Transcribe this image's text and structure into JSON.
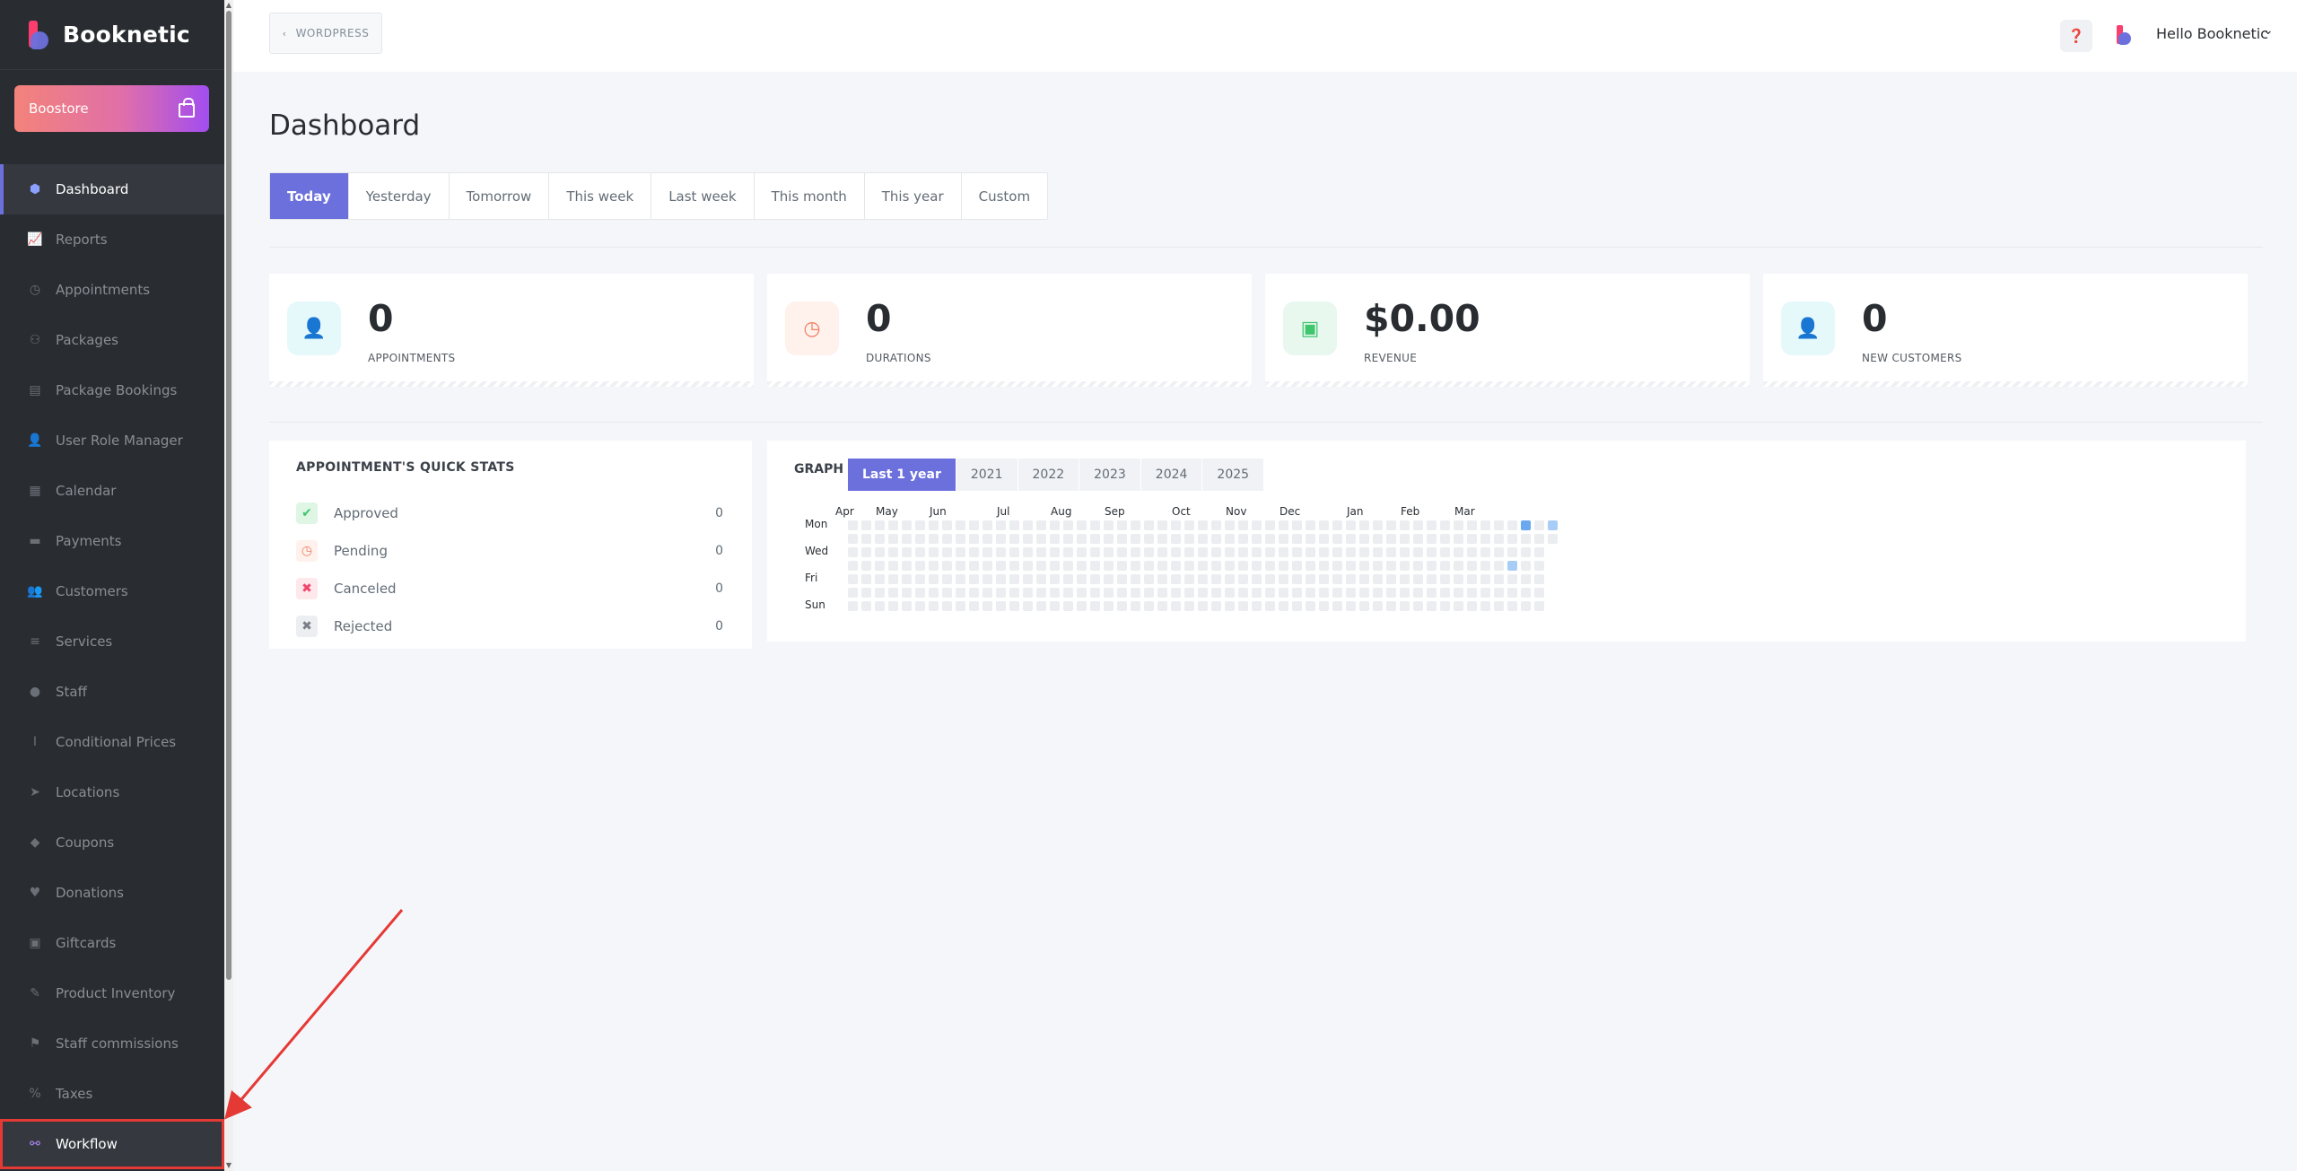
{
  "app": {
    "name": "Booknetic"
  },
  "sidebar": {
    "boostore_label": "Boostore",
    "items": [
      {
        "label": "Dashboard",
        "icon": "cube-icon",
        "glyph": "⬢",
        "state": "active"
      },
      {
        "label": "Reports",
        "icon": "chart-icon",
        "glyph": "📈",
        "state": ""
      },
      {
        "label": "Appointments",
        "icon": "clock-icon",
        "glyph": "◷",
        "state": ""
      },
      {
        "label": "Packages",
        "icon": "packages-icon",
        "glyph": "⚇",
        "state": ""
      },
      {
        "label": "Package Bookings",
        "icon": "package-bookings-icon",
        "glyph": "▤",
        "state": ""
      },
      {
        "label": "User Role Manager",
        "icon": "user-role-icon",
        "glyph": "👤",
        "state": ""
      },
      {
        "label": "Calendar",
        "icon": "calendar-icon",
        "glyph": "▦",
        "state": ""
      },
      {
        "label": "Payments",
        "icon": "payments-icon",
        "glyph": "▬",
        "state": ""
      },
      {
        "label": "Customers",
        "icon": "customers-icon",
        "glyph": "👥",
        "state": ""
      },
      {
        "label": "Services",
        "icon": "services-icon",
        "glyph": "≡",
        "state": ""
      },
      {
        "label": "Staff",
        "icon": "staff-icon",
        "glyph": "●",
        "state": ""
      },
      {
        "label": "Conditional Prices",
        "icon": "conditional-prices-icon",
        "glyph": "Ⅰ",
        "state": ""
      },
      {
        "label": "Locations",
        "icon": "location-arrow-icon",
        "glyph": "➤",
        "state": ""
      },
      {
        "label": "Coupons",
        "icon": "coupon-tag-icon",
        "glyph": "◆",
        "state": ""
      },
      {
        "label": "Donations",
        "icon": "donations-icon",
        "glyph": "♥",
        "state": ""
      },
      {
        "label": "Giftcards",
        "icon": "giftcard-icon",
        "glyph": "▣",
        "state": ""
      },
      {
        "label": "Product Inventory",
        "icon": "tools-icon",
        "glyph": "✎",
        "state": ""
      },
      {
        "label": "Staff commissions",
        "icon": "handshake-icon",
        "glyph": "⚑",
        "state": ""
      },
      {
        "label": "Taxes",
        "icon": "percent-icon",
        "glyph": "%",
        "state": ""
      },
      {
        "label": "Workflow",
        "icon": "workflow-icon",
        "glyph": "⚯",
        "state": "highlight"
      }
    ]
  },
  "header": {
    "back_label": "WORDPRESS",
    "user_greeting": "Hello Booknetic"
  },
  "main": {
    "title": "Dashboard",
    "date_tabs": [
      "Today",
      "Yesterday",
      "Tomorrow",
      "This week",
      "Last week",
      "This month",
      "This year",
      "Custom"
    ],
    "active_date_tab": 0,
    "stats": [
      {
        "value": "0",
        "label": "APPOINTMENTS",
        "icon": "user-icon",
        "glyph": "👤",
        "bg": "#e6f9fa",
        "fg": "#2cc7d1"
      },
      {
        "value": "0",
        "label": "DURATIONS",
        "icon": "clock-icon",
        "glyph": "◷",
        "bg": "#fff1ec",
        "fg": "#f37d63"
      },
      {
        "value": "$0.00",
        "label": "REVENUE",
        "icon": "wallet-icon",
        "glyph": "▣",
        "bg": "#e8f8ee",
        "fg": "#3ec66d"
      },
      {
        "value": "0",
        "label": "NEW CUSTOMERS",
        "icon": "user-icon",
        "glyph": "👤",
        "bg": "#e6f9fa",
        "fg": "#2cc7d1"
      }
    ],
    "quick_stats": {
      "title": "APPOINTMENT'S QUICK STATS",
      "rows": [
        {
          "label": "Approved",
          "count": "0",
          "icon": "check-icon",
          "glyph": "✔",
          "bg": "#dff6e5",
          "fg": "#3ec66d"
        },
        {
          "label": "Pending",
          "count": "0",
          "icon": "clock-icon",
          "glyph": "◷",
          "bg": "#fff1ec",
          "fg": "#f37d63"
        },
        {
          "label": "Canceled",
          "count": "0",
          "icon": "close-icon",
          "glyph": "✖",
          "bg": "#fde8ec",
          "fg": "#f0466c"
        },
        {
          "label": "Rejected",
          "count": "0",
          "icon": "close-icon",
          "glyph": "✖",
          "bg": "#eceef1",
          "fg": "#7b8088"
        }
      ]
    },
    "graph": {
      "title": "GRAPH",
      "year_tabs": [
        "Last 1 year",
        "2021",
        "2022",
        "2023",
        "2024",
        "2025"
      ],
      "active_year_tab": 0,
      "months": [
        "Apr",
        "May",
        "Jun",
        "Jul",
        "Aug",
        "Sep",
        "Oct",
        "Nov",
        "Dec",
        "Jan",
        "Feb",
        "Mar"
      ],
      "month_weeks": [
        0,
        3,
        7,
        12,
        16,
        20,
        25,
        29,
        33,
        38,
        42,
        46
      ],
      "days": [
        "Mon",
        "Wed",
        "Fri",
        "Sun"
      ],
      "weeks": 52,
      "last_week_days": 2,
      "active_cells": [
        {
          "week": 50,
          "day": 0,
          "level": 2
        },
        {
          "week": 52,
          "day": 0,
          "level": 1
        },
        {
          "week": 49,
          "day": 3,
          "level": 1
        }
      ]
    }
  }
}
